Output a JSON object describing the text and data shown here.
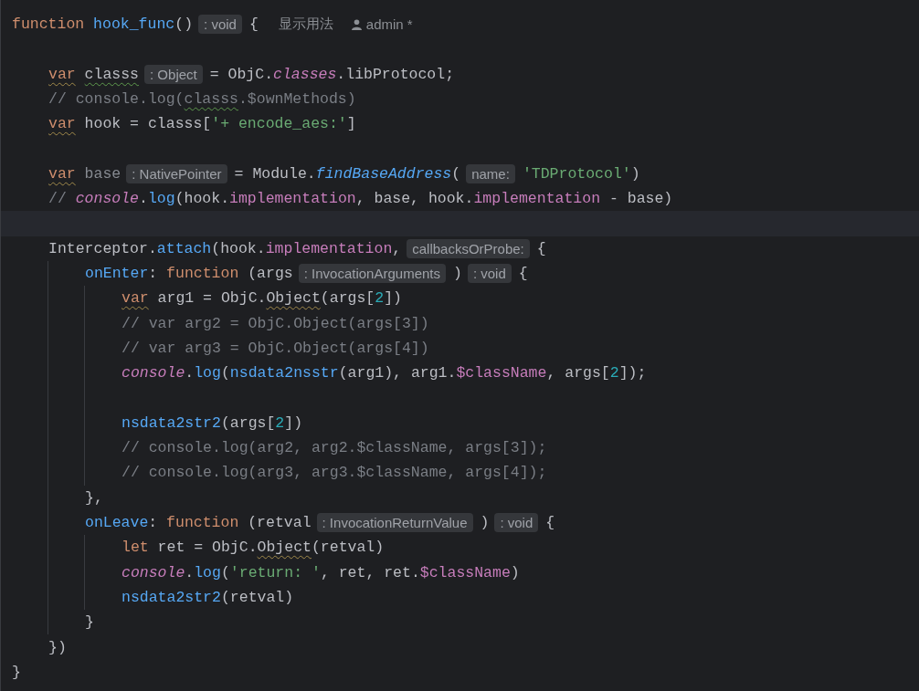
{
  "editor": {
    "lines": [
      {
        "tokens": [
          {
            "text": "function",
            "kind": "kw"
          },
          {
            "text": "hook_func",
            "kind": "fn"
          },
          {
            "text": "()",
            "kind": "plain"
          },
          {
            "text": ": void",
            "kind": "hint"
          },
          {
            "text": "{",
            "kind": "plain"
          },
          {
            "text": "显示用法",
            "kind": "usage"
          },
          {
            "text": "admin *",
            "kind": "author"
          }
        ],
        "children": [
          {
            "kind": "blank"
          },
          {
            "tokens": [
              {
                "text": "var",
                "kind": "kw",
                "warning": true
              },
              {
                "text": "classs",
                "kind": "plain",
                "typo": true
              },
              {
                "text": ": Object",
                "kind": "hint"
              },
              {
                "text": "= ObjC.",
                "kind": "plain"
              },
              {
                "text": "classes",
                "kind": "fldi"
              },
              {
                "text": ".libProtocol;",
                "kind": "plain"
              }
            ]
          },
          {
            "tokens": [
              {
                "text": "// console.log(",
                "kind": "cmt"
              },
              {
                "text": "classs",
                "kind": "cmt",
                "typo": true
              },
              {
                "text": ".$ownMethods)",
                "kind": "cmt"
              }
            ]
          },
          {
            "tokens": [
              {
                "text": "var",
                "kind": "kw",
                "warning": true
              },
              {
                "text": "hook = classs[",
                "kind": "plain"
              },
              {
                "text": "'+ encode_aes:'",
                "kind": "str"
              },
              {
                "text": "]",
                "kind": "plain"
              }
            ]
          },
          {
            "kind": "blank"
          },
          {
            "tokens": [
              {
                "text": "var",
                "kind": "kw",
                "warning": true
              },
              {
                "text": "base",
                "kind": "dim"
              },
              {
                "text": ": NativePointer",
                "kind": "hint"
              },
              {
                "text": "= Module.",
                "kind": "plain"
              },
              {
                "text": "findBaseAddress",
                "kind": "fni"
              },
              {
                "text": "(",
                "kind": "plain"
              },
              {
                "text": "name:",
                "kind": "hint"
              },
              {
                "text": "'TDProtocol'",
                "kind": "str"
              },
              {
                "text": ")",
                "kind": "plain"
              }
            ]
          },
          {
            "tokens": [
              {
                "text": "//",
                "kind": "cmt"
              },
              {
                "text": "console",
                "kind": "fldi"
              },
              {
                "text": ".",
                "kind": "plain"
              },
              {
                "text": "log",
                "kind": "fn"
              },
              {
                "text": "(hook.",
                "kind": "plain"
              },
              {
                "text": "implementation",
                "kind": "fld"
              },
              {
                "text": ", base, hook.",
                "kind": "plain"
              },
              {
                "text": "implementation",
                "kind": "fld"
              },
              {
                "text": " - base)",
                "kind": "plain"
              }
            ]
          },
          {
            "kind": "blank",
            "current": true
          },
          {
            "tokens": [
              {
                "text": "Interceptor.",
                "kind": "plain"
              },
              {
                "text": "attach",
                "kind": "fn"
              },
              {
                "text": "(hook.",
                "kind": "plain"
              },
              {
                "text": "implementation",
                "kind": "fld"
              },
              {
                "text": ",",
                "kind": "plain"
              },
              {
                "text": "callbacksOrProbe:",
                "kind": "hint"
              },
              {
                "text": "{",
                "kind": "plain"
              }
            ],
            "children": [
              {
                "tokens": [
                  {
                    "text": "onEnter",
                    "kind": "fn"
                  },
                  {
                    "text": ":",
                    "kind": "plain"
                  },
                  {
                    "text": "function",
                    "kind": "kw"
                  },
                  {
                    "text": "(args",
                    "kind": "plain"
                  },
                  {
                    "text": ": InvocationArguments",
                    "kind": "hint"
                  },
                  {
                    "text": ")",
                    "kind": "plain"
                  },
                  {
                    "text": ": void",
                    "kind": "hint"
                  },
                  {
                    "text": "{",
                    "kind": "plain"
                  }
                ],
                "children": [
                  {
                    "tokens": [
                      {
                        "text": "var",
                        "kind": "kw",
                        "warning": true
                      },
                      {
                        "text": "arg1 = ObjC.",
                        "kind": "plain"
                      },
                      {
                        "text": "Object",
                        "kind": "plain",
                        "warning": true
                      },
                      {
                        "text": "(args[",
                        "kind": "plain"
                      },
                      {
                        "text": "2",
                        "kind": "num"
                      },
                      {
                        "text": "])",
                        "kind": "plain"
                      }
                    ]
                  },
                  {
                    "tokens": [
                      {
                        "text": "// var arg2 = ObjC.Object(args[3])",
                        "kind": "cmt"
                      }
                    ]
                  },
                  {
                    "tokens": [
                      {
                        "text": "// var arg3 = ObjC.Object(args[4])",
                        "kind": "cmt"
                      }
                    ]
                  },
                  {
                    "tokens": [
                      {
                        "text": "console",
                        "kind": "fldi"
                      },
                      {
                        "text": ".",
                        "kind": "plain"
                      },
                      {
                        "text": "log",
                        "kind": "fn"
                      },
                      {
                        "text": "(",
                        "kind": "plain"
                      },
                      {
                        "text": "nsdata2nsstr",
                        "kind": "fn"
                      },
                      {
                        "text": "(arg1), arg1.",
                        "kind": "plain"
                      },
                      {
                        "text": "$className",
                        "kind": "fld"
                      },
                      {
                        "text": ", args[",
                        "kind": "plain"
                      },
                      {
                        "text": "2",
                        "kind": "num"
                      },
                      {
                        "text": "]);",
                        "kind": "plain"
                      }
                    ]
                  },
                  {
                    "kind": "blank"
                  },
                  {
                    "tokens": [
                      {
                        "text": "nsdata2str2",
                        "kind": "fn"
                      },
                      {
                        "text": "(args[",
                        "kind": "plain"
                      },
                      {
                        "text": "2",
                        "kind": "num"
                      },
                      {
                        "text": "])",
                        "kind": "plain"
                      }
                    ]
                  },
                  {
                    "tokens": [
                      {
                        "text": "// console.log(arg2, arg2.$className, args[3]);",
                        "kind": "cmt"
                      }
                    ]
                  },
                  {
                    "tokens": [
                      {
                        "text": "// console.log(arg3, arg3.$className, args[4]);",
                        "kind": "cmt"
                      }
                    ]
                  }
                ]
              },
              {
                "tokens": [
                  {
                    "text": "},",
                    "kind": "plain"
                  }
                ]
              },
              {
                "tokens": [
                  {
                    "text": "onLeave",
                    "kind": "fn"
                  },
                  {
                    "text": ":",
                    "kind": "plain"
                  },
                  {
                    "text": "function",
                    "kind": "kw"
                  },
                  {
                    "text": "(retval",
                    "kind": "plain"
                  },
                  {
                    "text": ": InvocationReturnValue",
                    "kind": "hint"
                  },
                  {
                    "text": ")",
                    "kind": "plain"
                  },
                  {
                    "text": ": void",
                    "kind": "hint"
                  },
                  {
                    "text": "{",
                    "kind": "plain"
                  }
                ],
                "children": [
                  {
                    "tokens": [
                      {
                        "text": "let",
                        "kind": "kw"
                      },
                      {
                        "text": "ret = ObjC.",
                        "kind": "plain"
                      },
                      {
                        "text": "Object",
                        "kind": "plain",
                        "warning": true
                      },
                      {
                        "text": "(retval)",
                        "kind": "plain"
                      }
                    ]
                  },
                  {
                    "tokens": [
                      {
                        "text": "console",
                        "kind": "fldi"
                      },
                      {
                        "text": ".",
                        "kind": "plain"
                      },
                      {
                        "text": "log",
                        "kind": "fn"
                      },
                      {
                        "text": "(",
                        "kind": "plain"
                      },
                      {
                        "text": "'return: '",
                        "kind": "str"
                      },
                      {
                        "text": ", ret, ret.",
                        "kind": "plain"
                      },
                      {
                        "text": "$className",
                        "kind": "fld"
                      },
                      {
                        "text": ")",
                        "kind": "plain"
                      }
                    ]
                  },
                  {
                    "tokens": [
                      {
                        "text": "nsdata2str2",
                        "kind": "fn"
                      },
                      {
                        "text": "(retval)",
                        "kind": "plain"
                      }
                    ]
                  }
                ]
              },
              {
                "tokens": [
                  {
                    "text": "}",
                    "kind": "plain"
                  }
                ]
              }
            ]
          },
          {
            "tokens": [
              {
                "text": "})",
                "kind": "plain"
              }
            ]
          }
        ]
      },
      {
        "tokens": [
          {
            "text": "}",
            "kind": "plain"
          }
        ]
      }
    ]
  }
}
